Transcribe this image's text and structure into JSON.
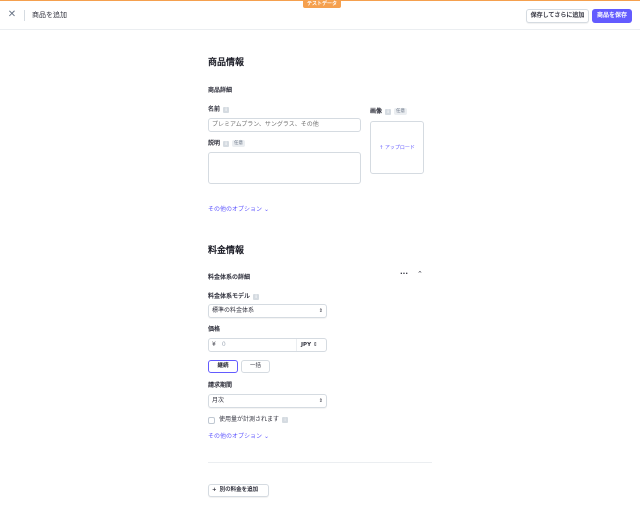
{
  "test_badge": "テストデータ",
  "header": {
    "title": "商品を追加",
    "save_and_add_label": "保存してさらに追加",
    "save_label": "商品を保存"
  },
  "product": {
    "section_title": "商品情報",
    "details_title": "商品詳細",
    "name_label": "名前",
    "name_placeholder": "プレミアムプラン、サングラス、その他",
    "description_label": "説明",
    "optional_badge": "任意",
    "image_label": "画像",
    "upload_label": "アップロード",
    "more_options": "その他のオプション"
  },
  "pricing": {
    "section_title": "料金情報",
    "details_title": "料金体系の詳細",
    "model_label": "料金体系モデル",
    "model_value": "標準の料金体系",
    "price_label": "価格",
    "currency_symbol": "¥",
    "price_placeholder": "0",
    "currency": "JPY",
    "recurring_label": "継続",
    "one_time_label": "一括",
    "billing_period_label": "請求期間",
    "billing_period_value": "月次",
    "metered_label": "使用量が計測されます",
    "metered_checked": false,
    "more_options": "その他のオプション",
    "add_price_label": "別の料金を追加"
  },
  "colors": {
    "accent": "#635bff",
    "test_mode": "#f5a04e"
  }
}
